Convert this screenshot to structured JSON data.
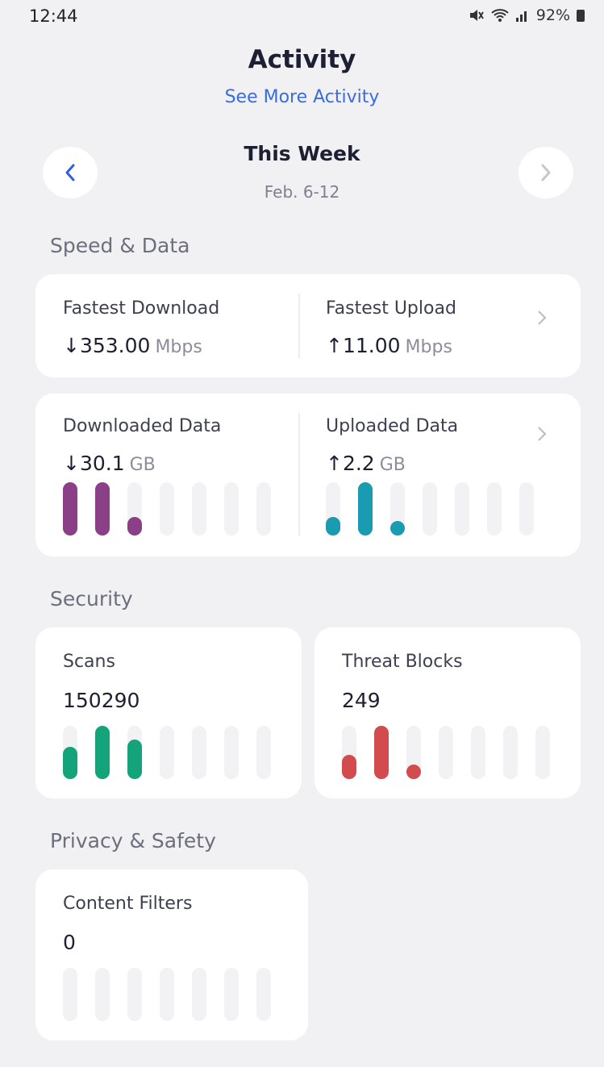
{
  "status_bar": {
    "time": "12:44",
    "battery": "92%"
  },
  "header": {
    "title": "Activity",
    "link": "See More Activity"
  },
  "period": {
    "title": "This Week",
    "range": "Feb. 6-12"
  },
  "speed_data": {
    "title": "Speed & Data",
    "fastest_download": {
      "label": "Fastest Download",
      "arrow": "↓",
      "value": "353.00",
      "unit": "Mbps"
    },
    "fastest_upload": {
      "label": "Fastest Upload",
      "arrow": "↑",
      "value": "11.00",
      "unit": "Mbps"
    },
    "downloaded": {
      "label": "Downloaded Data",
      "arrow": "↓",
      "value": "30.1",
      "unit": "GB",
      "color": "#8a3f86",
      "levels": [
        1.0,
        1.0,
        0.35,
        0,
        0,
        0,
        0
      ]
    },
    "uploaded": {
      "label": "Uploaded Data",
      "arrow": "↑",
      "value": "2.2",
      "unit": "GB",
      "color": "#1a9bb2",
      "levels": [
        0.35,
        1.0,
        0.2,
        0,
        0,
        0,
        0
      ]
    }
  },
  "security": {
    "title": "Security",
    "scans": {
      "label": "Scans",
      "value": "150290",
      "color": "#14a37a",
      "levels": [
        0.6,
        1.0,
        0.75,
        0,
        0,
        0,
        0
      ]
    },
    "threat_blocks": {
      "label": "Threat Blocks",
      "value": "249",
      "color": "#d24b4f",
      "levels": [
        0.45,
        1.0,
        0.25,
        0,
        0,
        0,
        0
      ]
    }
  },
  "privacy": {
    "title": "Privacy & Safety",
    "content_filters": {
      "label": "Content Filters",
      "value": "0",
      "color": "#cccccc",
      "levels": [
        0,
        0,
        0,
        0,
        0,
        0,
        0
      ]
    }
  },
  "icons": {
    "prev": "chevron-left-icon",
    "next": "chevron-right-icon",
    "mute": "mute-icon",
    "wifi": "wifi-icon",
    "signal": "signal-icon",
    "battery": "battery-icon"
  }
}
